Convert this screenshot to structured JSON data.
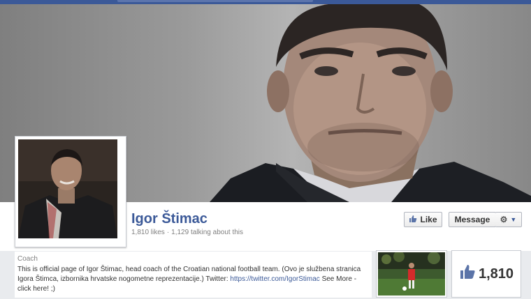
{
  "page": {
    "name": "Igor Štimac",
    "likes_count": "1,810 likes",
    "talking_about": "1,129 talking about this",
    "separator": "·"
  },
  "actions": {
    "like_label": "Like",
    "message_label": "Message",
    "like_icon": "thumbs-up-icon",
    "settings_icon": "gear-icon"
  },
  "about": {
    "category": "Coach",
    "description": "This is official page of Igor Štimac, head coach of the Croatian national football team. (Ovo je službena stranica Igora Štimca, izbornika hrvatske nogometne reprezentacije.) Twitter:",
    "twitter_link": "https://twitter.com/IgorStimac",
    "see_more": "See More - click here! ;)"
  },
  "likes_box": {
    "count": "1,810",
    "icon": "thumbs-up-icon"
  },
  "colors": {
    "brand": "#3b5998",
    "link": "#3b5998",
    "background": "#e9ebee"
  }
}
